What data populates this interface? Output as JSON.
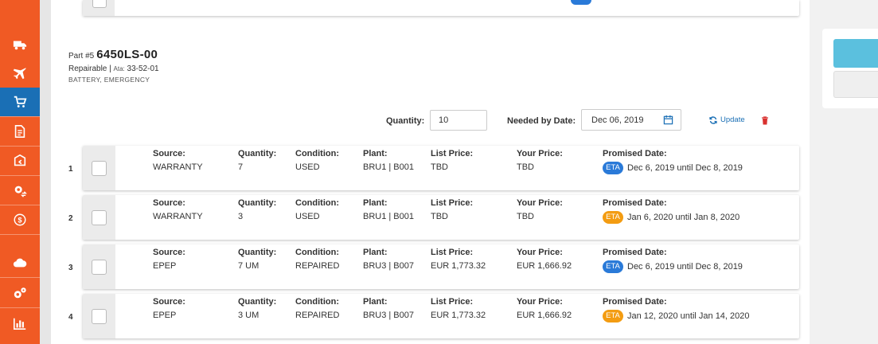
{
  "sidebar": {
    "items": [
      {
        "icon": "truck-icon"
      },
      {
        "icon": "plane-icon"
      },
      {
        "icon": "cart-icon",
        "active": true
      },
      {
        "icon": "document-icon"
      },
      {
        "icon": "return-box-icon"
      },
      {
        "icon": "cog-swap-icon"
      },
      {
        "icon": "dollar-cycle-icon"
      },
      {
        "icon": "cloud-icon"
      },
      {
        "icon": "cogs-icon"
      },
      {
        "icon": "bar-chart-icon"
      }
    ],
    "color": "#f05a24",
    "active_color": "#1a6fb5"
  },
  "part": {
    "prefix": "Part #5",
    "number": "6450LS-00",
    "status": "Repairable |",
    "ata_label": "Ata:",
    "ata_value": "33-52-01",
    "description": "BATTERY, EMERGENCY"
  },
  "controls": {
    "quantity_label": "Quantity:",
    "quantity_value": "10",
    "date_label": "Needed by Date:",
    "date_value": "Dec 06, 2019",
    "update_label": "Update"
  },
  "column_labels": {
    "source": "Source:",
    "quantity": "Quantity:",
    "condition": "Condition:",
    "plant": "Plant:",
    "list_price": "List Price:",
    "your_price": "Your Price:",
    "promised_date": "Promised Date:"
  },
  "eta_label": "ETA",
  "eta_colors": {
    "blue": "#2a7ad8",
    "orange": "#f39c12"
  },
  "rows": [
    {
      "index": "1",
      "source": "WARRANTY",
      "quantity": "7",
      "condition": "USED",
      "plant": "BRU1 | B001",
      "list_price": "TBD",
      "your_price": "TBD",
      "eta_color": "blue",
      "promised": "Dec 6, 2019 until Dec 8, 2019"
    },
    {
      "index": "2",
      "source": "WARRANTY",
      "quantity": "3",
      "condition": "USED",
      "plant": "BRU1 | B001",
      "list_price": "TBD",
      "your_price": "TBD",
      "eta_color": "orange",
      "promised": "Jan 6, 2020 until Jan 8, 2020"
    },
    {
      "index": "3",
      "source": "EPEP",
      "quantity": "7 UM",
      "condition": "REPAIRED",
      "plant": "BRU3 | B007",
      "list_price": "EUR 1,773.32",
      "your_price": "EUR 1,666.92",
      "eta_color": "blue",
      "promised": "Dec 6, 2019 until Dec 8, 2019"
    },
    {
      "index": "4",
      "source": "EPEP",
      "quantity": "3 UM",
      "condition": "REPAIRED",
      "plant": "BRU3 | B007",
      "list_price": "EUR 1,773.32",
      "your_price": "EUR 1,666.92",
      "eta_color": "orange",
      "promised": "Jan 12, 2020 until Jan 14, 2020"
    }
  ]
}
